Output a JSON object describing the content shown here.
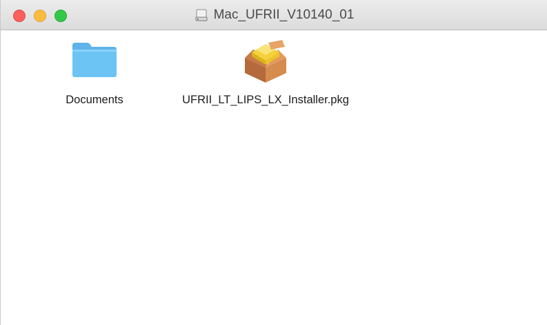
{
  "window": {
    "title": "Mac_UFRII_V10140_01",
    "title_icon": "disk-icon"
  },
  "colors": {
    "close": "#fc605c",
    "minimize": "#fdbc40",
    "zoom": "#34c84a",
    "folder": "#6cc4f5"
  },
  "files": [
    {
      "name": "Documents",
      "icon": "folder-icon"
    },
    {
      "name": "UFRII_LT_LIPS_LX_Installer.pkg",
      "icon": "package-icon"
    }
  ]
}
